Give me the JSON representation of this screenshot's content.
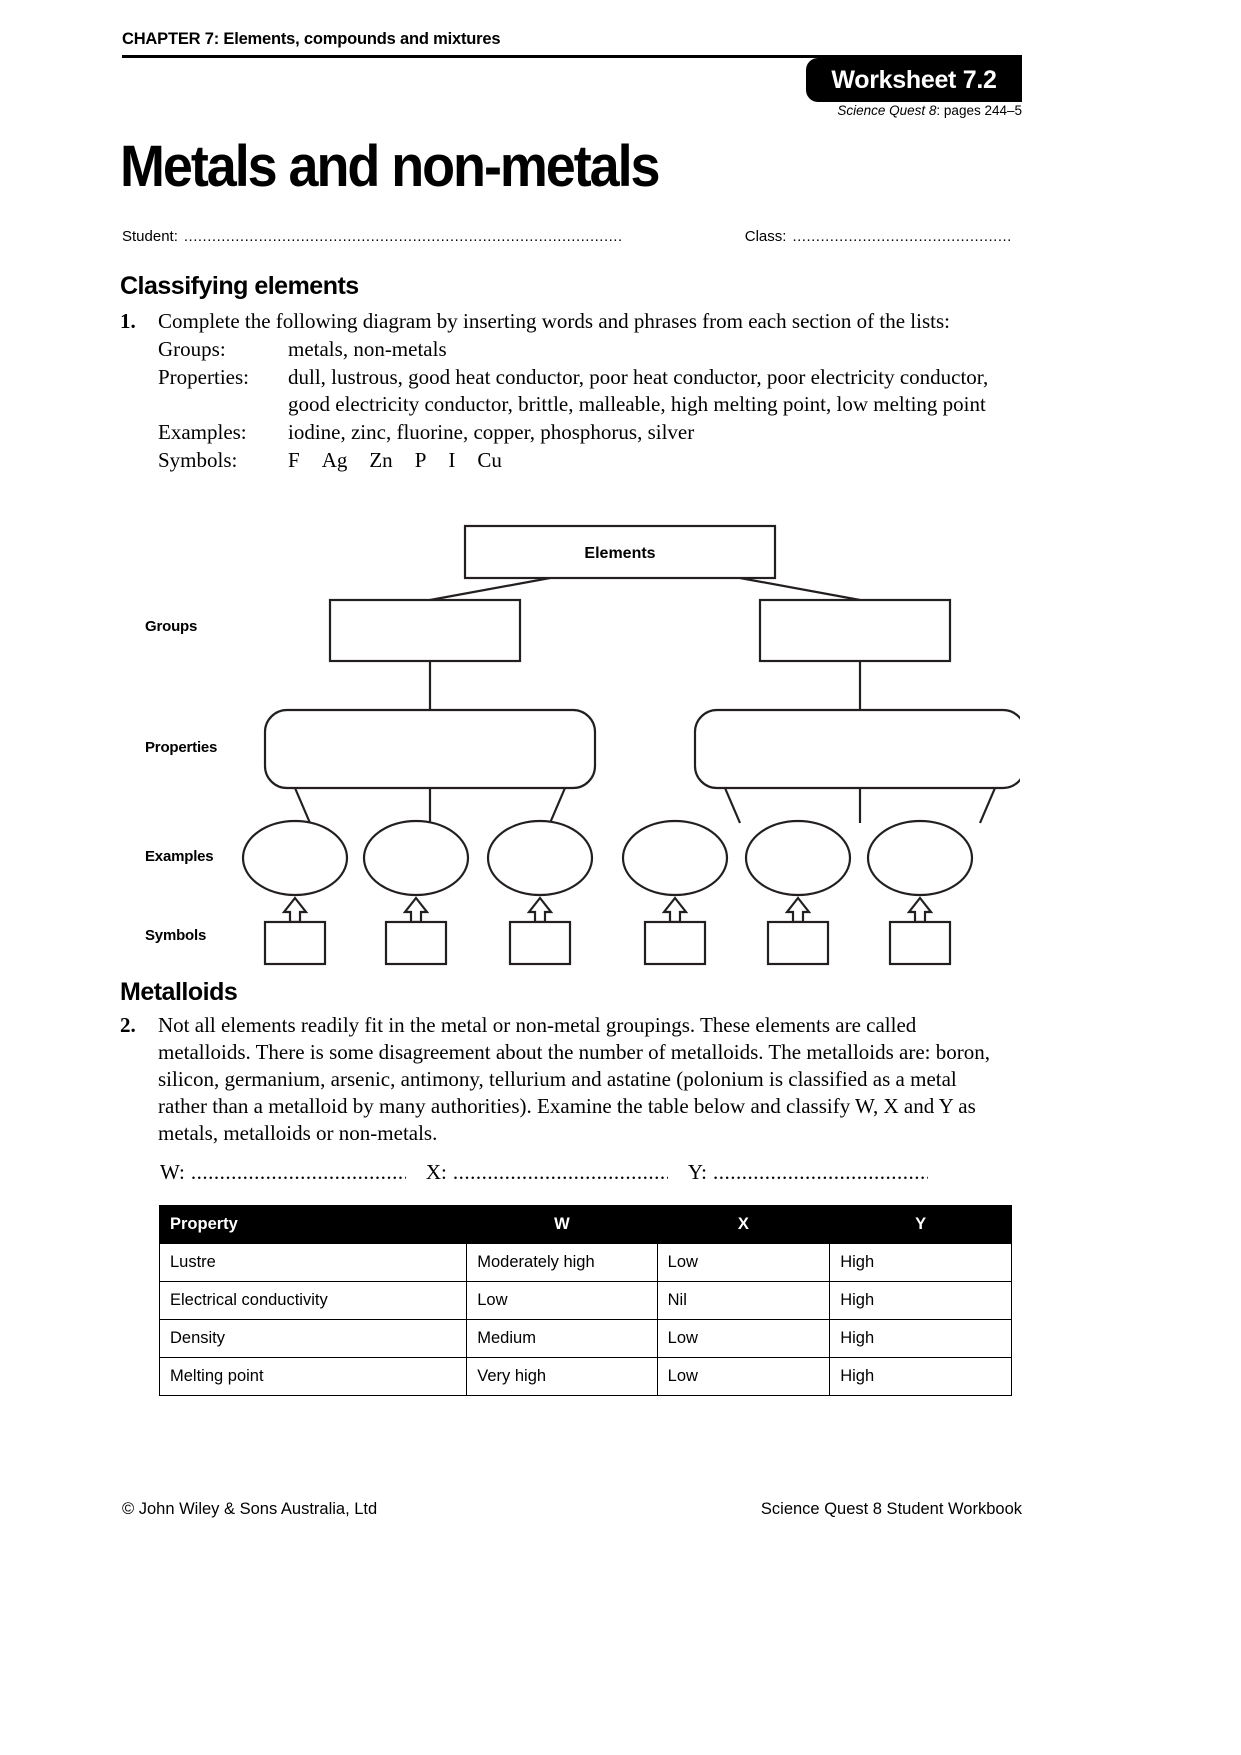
{
  "header": {
    "chapter": "CHAPTER 7: Elements, compounds and mixtures",
    "worksheet_tag": "Worksheet 7.2",
    "source_italic": "Science Quest 8",
    "source_rest": ": pages 244–5"
  },
  "title": "Metals and non-metals",
  "student_line": {
    "student_label": "Student:",
    "student_dots": "..............................................................................................",
    "class_label": "Class:",
    "class_dots": "..............................................."
  },
  "sections": {
    "classifying_heading": "Classifying elements",
    "metalloids_heading": "Metalloids"
  },
  "question1": {
    "number": "1.",
    "text": "Complete the following diagram by inserting words and phrases from each section of the lists:",
    "lists": [
      {
        "key": "Groups:",
        "value": "metals, non-metals"
      },
      {
        "key": "Properties:",
        "value": "dull, lustrous, good heat conductor, poor heat conductor, poor electricity conductor, good electricity conductor, brittle, malleable, high melting point, low melting point"
      },
      {
        "key": "Examples:",
        "value": "iodine, zinc, fluorine, copper, phosphorus, silver"
      }
    ],
    "symbols_key": "Symbols:",
    "symbols": [
      "F",
      "Ag",
      "Zn",
      "P",
      "I",
      "Cu"
    ]
  },
  "diagram": {
    "root_label": "Elements",
    "row_labels": [
      "Groups",
      "Properties",
      "Examples",
      "Symbols"
    ],
    "group_boxes": [
      "",
      ""
    ],
    "property_boxes": [
      "",
      ""
    ],
    "example_ellipses": [
      "",
      "",
      "",
      "",
      "",
      ""
    ],
    "symbol_boxes": [
      "",
      "",
      "",
      "",
      "",
      ""
    ]
  },
  "question2": {
    "number": "2.",
    "text": "Not all elements readily fit in the metal or non-metal groupings. These elements are called metalloids. There is some disagreement about the number of metalloids. The metalloids are: boron, silicon, germanium, arsenic, antimony, tellurium and astatine (polonium is classified as a metal rather than a metalloid by many authorities). Examine the table below and classify W, X and Y as metals, metalloids or non-metals.",
    "answers": [
      {
        "label": "W:",
        "dots": "......................................"
      },
      {
        "label": "X:",
        "dots": "......................................"
      },
      {
        "label": "Y:",
        "dots": "......................................."
      }
    ]
  },
  "table": {
    "headers": [
      "Property",
      "W",
      "X",
      "Y"
    ],
    "rows": [
      [
        "Lustre",
        "Moderately high",
        "Low",
        "High"
      ],
      [
        "Electrical conductivity",
        "Low",
        "Nil",
        "High"
      ],
      [
        "Density",
        "Medium",
        "Low",
        "High"
      ],
      [
        "Melting point",
        "Very high",
        "Low",
        "High"
      ]
    ]
  },
  "footer": {
    "left": "© John Wiley & Sons Australia, Ltd",
    "right": "Science Quest 8 Student Workbook"
  },
  "colors": {
    "ink": "#000000",
    "stroke": "#231f20",
    "paper": "#ffffff"
  }
}
